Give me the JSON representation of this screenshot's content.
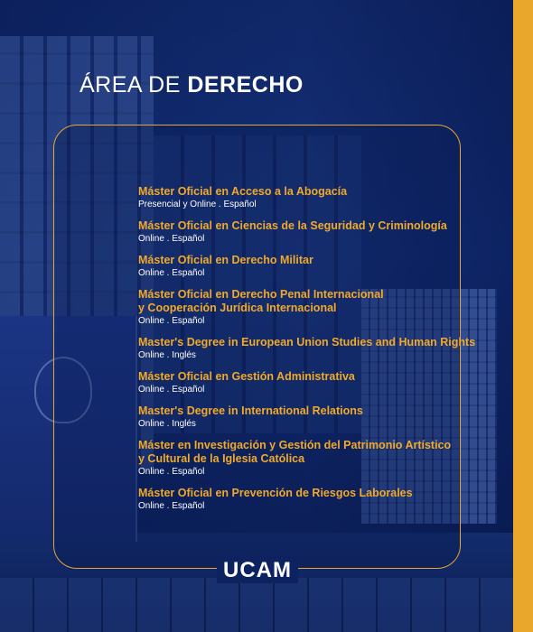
{
  "title": {
    "light": "ÁREA DE ",
    "bold": "DERECHO"
  },
  "programs": [
    {
      "lines": [
        "Máster Oficial en Acceso a la Abogacía"
      ],
      "meta": "Presencial y Online . Español"
    },
    {
      "lines": [
        "Máster Oficial en Ciencias de la Seguridad y Criminología"
      ],
      "meta": "Online . Español"
    },
    {
      "lines": [
        "Máster Oficial en Derecho Militar"
      ],
      "meta": "Online . Español"
    },
    {
      "lines": [
        "Máster Oficial en Derecho Penal Internacional",
        "y Cooperación Jurídica Internacional"
      ],
      "meta": "Online . Español"
    },
    {
      "lines": [
        "Master's Degree in European Union Studies and Human Rights"
      ],
      "meta": "Online . Inglés"
    },
    {
      "lines": [
        "Máster Oficial en Gestión Administrativa"
      ],
      "meta": "Online . Español"
    },
    {
      "lines": [
        "Master's Degree in International Relations"
      ],
      "meta": "Online . Inglés"
    },
    {
      "lines": [
        "Máster en Investigación y Gestión del Patrimonio Artístico",
        "y Cultural de la Iglesia Católica"
      ],
      "meta": "Online . Español"
    },
    {
      "lines": [
        "Máster Oficial en Prevención de Riesgos Laborales"
      ],
      "meta": "Online . Español"
    }
  ],
  "logo": "UCAM",
  "colors": {
    "accent": "#e9a72c",
    "background": "#0f2a6e",
    "text": "#ffffff"
  }
}
